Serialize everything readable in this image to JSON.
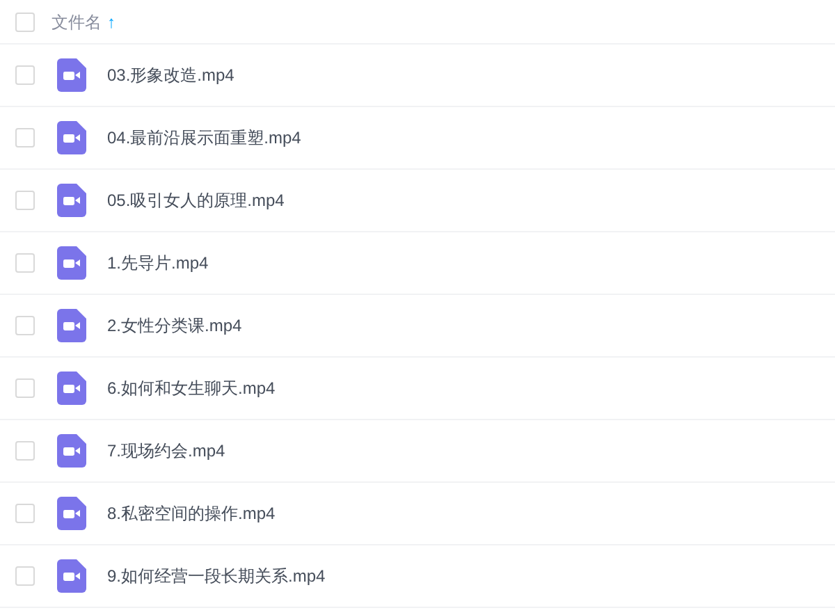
{
  "header": {
    "checked": false,
    "column_label": "文件名",
    "sort_indicator": "↑"
  },
  "files": [
    {
      "name": "03.形象改造.mp4",
      "checked": false
    },
    {
      "name": "04.最前沿展示面重塑.mp4",
      "checked": false
    },
    {
      "name": "05.吸引女人的原理.mp4",
      "checked": false
    },
    {
      "name": "1.先导片.mp4",
      "checked": false
    },
    {
      "name": "2.女性分类课.mp4",
      "checked": false
    },
    {
      "name": "6.如何和女生聊天.mp4",
      "checked": false
    },
    {
      "name": "7.现场约会.mp4",
      "checked": false
    },
    {
      "name": "8.私密空间的操作.mp4",
      "checked": false
    },
    {
      "name": "9.如何经营一段长期关系.mp4",
      "checked": false
    }
  ]
}
